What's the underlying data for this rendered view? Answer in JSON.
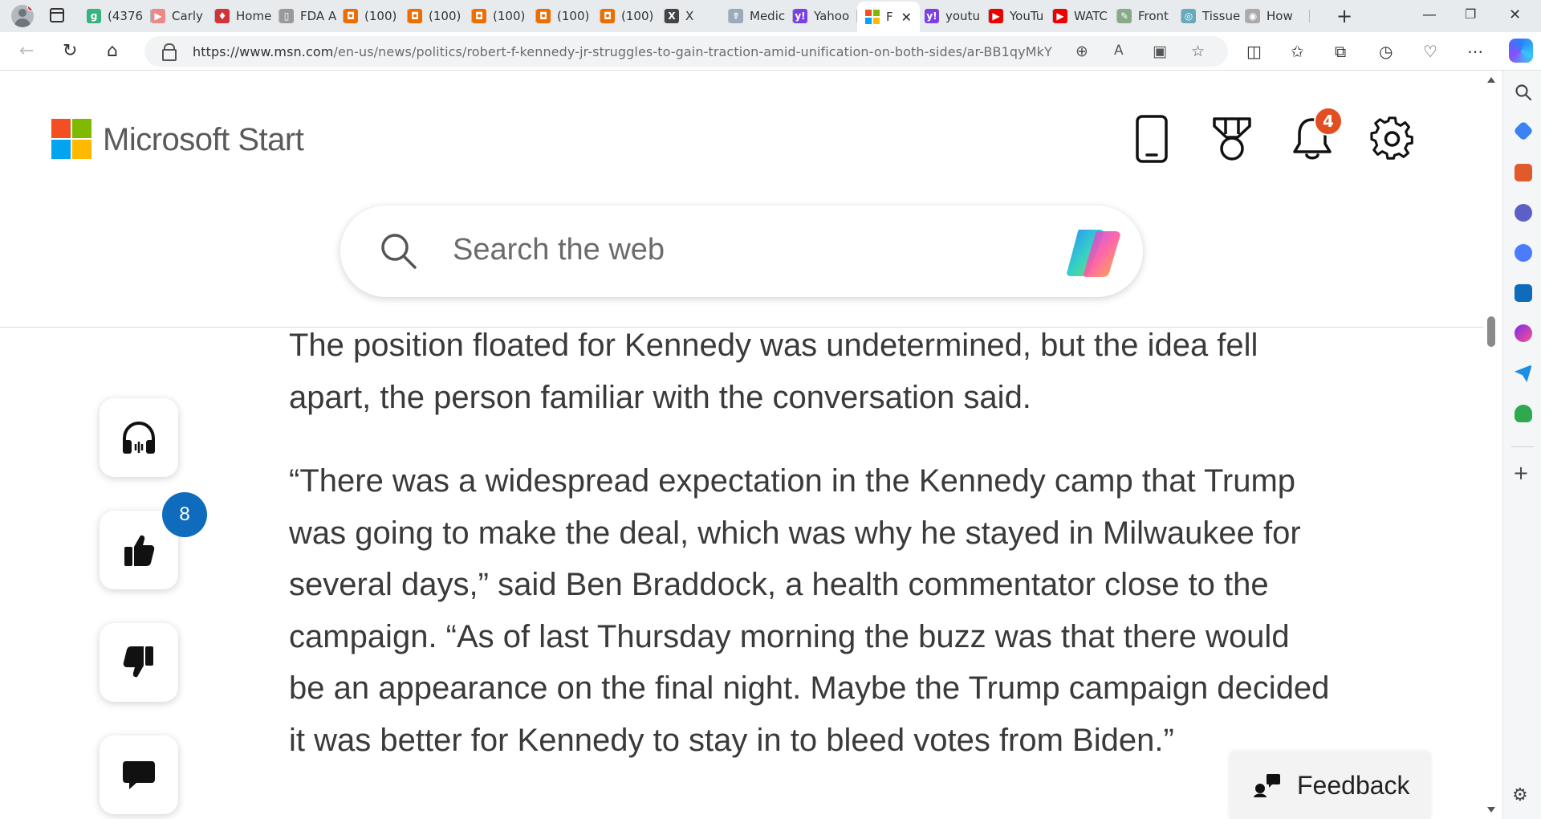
{
  "browser": {
    "tabs": [
      {
        "label": "(4376",
        "favicon": "g",
        "color": "#36b37e"
      },
      {
        "label": "Carly",
        "favicon": "▶",
        "color": "#e88"
      },
      {
        "label": "Home",
        "favicon": "♦",
        "color": "#d13438"
      },
      {
        "label": "FDA A",
        "favicon": "▯",
        "color": "#999"
      },
      {
        "label": "(100)",
        "favicon": "◘",
        "color": "#ef6c00"
      },
      {
        "label": "(100)",
        "favicon": "◘",
        "color": "#ef6c00"
      },
      {
        "label": "(100)",
        "favicon": "◘",
        "color": "#ef6c00"
      },
      {
        "label": "(100)",
        "favicon": "◘",
        "color": "#ef6c00"
      },
      {
        "label": "(100)",
        "favicon": "◘",
        "color": "#ef6c00"
      },
      {
        "label": "X",
        "favicon": "X",
        "color": "#444"
      },
      {
        "label": "Medic",
        "favicon": "☤",
        "color": "#9ab"
      },
      {
        "label": "Yahoo",
        "favicon": "y!",
        "color": "#7b3fe4"
      },
      {
        "label": "F",
        "favicon": "⊞",
        "color": "#fff",
        "active": true
      },
      {
        "label": "youtu",
        "favicon": "y!",
        "color": "#7b3fe4"
      },
      {
        "label": "YouTu",
        "favicon": "▶",
        "color": "#e00"
      },
      {
        "label": "WATC",
        "favicon": "▶",
        "color": "#e00"
      },
      {
        "label": "Front",
        "favicon": "✎",
        "color": "#8a8"
      },
      {
        "label": "Tissue",
        "favicon": "◎",
        "color": "#6ab"
      },
      {
        "label": "How",
        "favicon": "◉",
        "color": "#aaa"
      }
    ],
    "url_host": "https://www.msn.com",
    "url_path": "/en-us/news/politics/robert-f-kennedy-jr-struggles-to-gain-traction-amid-unification-on-both-sides/ar-BB1qyMkY"
  },
  "header": {
    "brand": "Microsoft Start",
    "notification_count": "4",
    "search_placeholder": "Search the web"
  },
  "rail": {
    "like_count": "8"
  },
  "article": {
    "paragraphs": [
      "The position floated for Kennedy was undetermined, but the idea fell apart, the person familiar with the conversation said.",
      "“There was a widespread expectation in the Kennedy camp that Trump was going to make the deal, which was why he stayed in Milwaukee for several days,” said Ben Braddock, a health commentator close to the campaign. “As of last Thursday morning the buzz was that there would be an appearance on the final night. Maybe the Trump campaign decided it was better for Kennedy to stay in to bleed votes from Biden.”"
    ]
  },
  "feedback": {
    "label": "Feedback"
  },
  "colors": {
    "ms_red": "#f25022",
    "ms_green": "#7fba00",
    "ms_blue": "#00a4ef",
    "ms_yellow": "#ffb900",
    "notification_badge": "#e04e22",
    "like_badge": "#0f6cbd"
  }
}
